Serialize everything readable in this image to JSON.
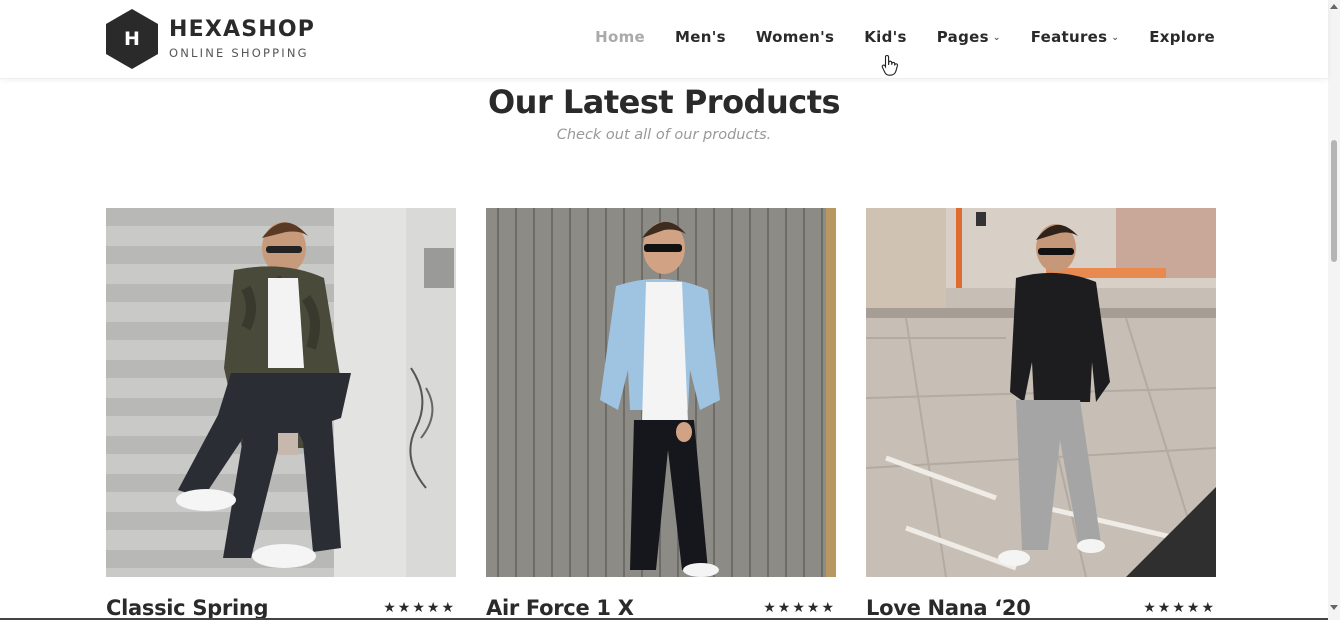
{
  "brand": {
    "letter": "H",
    "name": "HEXASHOP",
    "tagline": "ONLINE SHOPPING"
  },
  "nav": [
    {
      "label": "Home",
      "active": true,
      "dropdown": false
    },
    {
      "label": "Men's",
      "active": false,
      "dropdown": false
    },
    {
      "label": "Women's",
      "active": false,
      "dropdown": false
    },
    {
      "label": "Kid's",
      "active": false,
      "dropdown": false
    },
    {
      "label": "Pages",
      "active": false,
      "dropdown": true
    },
    {
      "label": "Features",
      "active": false,
      "dropdown": true
    },
    {
      "label": "Explore",
      "active": false,
      "dropdown": false
    }
  ],
  "section": {
    "title": "Our Latest Products",
    "subtitle": "Check out all of our products."
  },
  "products": [
    {
      "name": "Classic Spring",
      "rating": "★★★★★"
    },
    {
      "name": "Air Force 1 X",
      "rating": "★★★★★"
    },
    {
      "name": "Love Nana ‘20",
      "rating": "★★★★★"
    }
  ],
  "colors": {
    "dark": "#2a2a2a",
    "muted": "#999999",
    "active_nav": "#aaaaaa"
  }
}
